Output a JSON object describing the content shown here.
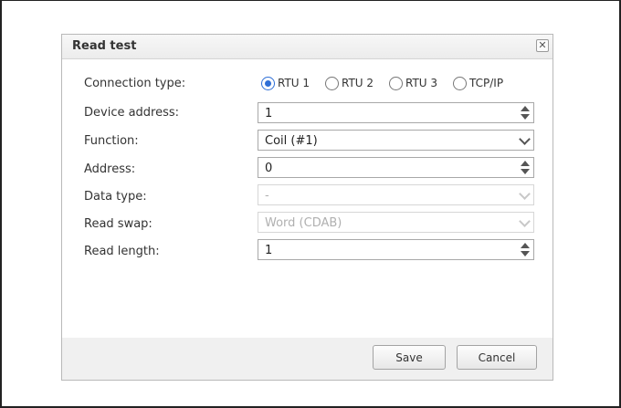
{
  "dialog": {
    "title": "Read test",
    "close_icon": "close-icon",
    "close_glyph": "✕"
  },
  "form": {
    "connection_type": {
      "label": "Connection type:",
      "options": [
        {
          "label": "RTU 1",
          "selected": true
        },
        {
          "label": "RTU 2",
          "selected": false
        },
        {
          "label": "RTU 3",
          "selected": false
        },
        {
          "label": "TCP/IP",
          "selected": false
        }
      ]
    },
    "device_address": {
      "label": "Device address:",
      "value": "1"
    },
    "function": {
      "label": "Function:",
      "value": "Coil (#1)"
    },
    "address": {
      "label": "Address:",
      "value": "0"
    },
    "data_type": {
      "label": "Data type:",
      "value": "-"
    },
    "read_swap": {
      "label": "Read swap:",
      "value": "Word (CDAB)"
    },
    "read_length": {
      "label": "Read length:",
      "value": "1"
    }
  },
  "footer": {
    "save_label": "Save",
    "cancel_label": "Cancel"
  },
  "colors": {
    "accent": "#2f6fd6",
    "footer_bg": "#f0f0f0"
  }
}
